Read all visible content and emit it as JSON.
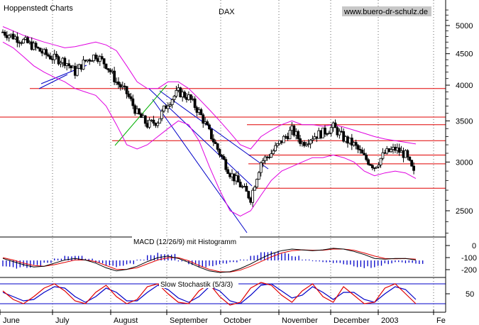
{
  "header": {
    "source": "Hoppenstedt Charts",
    "title": "DAX",
    "website": "www.buero-dr-schulz.de"
  },
  "chart_data": [
    {
      "type": "candlestick",
      "title": "DAX",
      "xlabel": "",
      "ylabel": "",
      "yscale": "log",
      "x_ticks": [
        "June",
        "July",
        "August",
        "September",
        "October",
        "November",
        "December",
        "2003",
        "Fe"
      ],
      "y_ticks": [
        2500,
        3000,
        3500,
        4000,
        4500,
        5000
      ],
      "ylim": [
        2000,
        5300
      ],
      "grid": "vertical dotted",
      "close_by_week": [
        4880,
        4800,
        4720,
        4620,
        4500,
        4420,
        4380,
        4200,
        4380,
        4480,
        4320,
        4050,
        3880,
        3600,
        3450,
        3500,
        3750,
        3900,
        3820,
        3620,
        3350,
        3100,
        2880,
        2750,
        2620,
        3000,
        3100,
        3250,
        3380,
        3220,
        3300,
        3350,
        3420,
        3280,
        3200,
        3050,
        2950,
        3100,
        3150,
        3080,
        2820
      ],
      "horizontal_levels": [
        3950,
        3550,
        3450,
        3250,
        3080,
        2980,
        2720
      ],
      "bollinger_upper": [
        4980,
        4900,
        4820,
        4760,
        4700,
        4650,
        4600,
        4620,
        4660,
        4700,
        4650,
        4550,
        4300,
        4050,
        3950,
        3950,
        4050,
        4050,
        3950,
        3800,
        3650,
        3500,
        3350,
        3200,
        3150,
        3300,
        3380,
        3450,
        3500,
        3450,
        3450,
        3430,
        3450,
        3420,
        3380,
        3340,
        3300,
        3270,
        3250,
        3230,
        3210
      ],
      "bollinger_lower": [
        4700,
        4600,
        4450,
        4300,
        4200,
        4120,
        4050,
        3950,
        3900,
        3850,
        3700,
        3450,
        3200,
        3150,
        3200,
        3300,
        3400,
        3500,
        3450,
        3250,
        2950,
        2700,
        2500,
        2450,
        2500,
        2650,
        2800,
        2900,
        2950,
        3000,
        3050,
        3050,
        3080,
        3050,
        3000,
        2900,
        2850,
        2880,
        2900,
        2880,
        2820
      ]
    },
    {
      "type": "line",
      "title": "MACD (12/26/9) mit Histogramm",
      "y_ticks": [
        0,
        -100,
        -200
      ],
      "macd": [
        -20,
        -60,
        -100,
        -130,
        -120,
        -80,
        -40,
        -20,
        -40,
        -80,
        -140,
        -180,
        -160,
        -120,
        -60,
        -10,
        10,
        -20,
        -70,
        -130,
        -180,
        -200,
        -190,
        -150,
        -90,
        -20,
        40,
        80,
        100,
        90,
        80,
        90,
        110,
        100,
        70,
        30,
        -20,
        -30,
        -20,
        -20,
        -40
      ],
      "signal": [
        -10,
        -40,
        -80,
        -110,
        -120,
        -100,
        -70,
        -40,
        -40,
        -60,
        -110,
        -160,
        -160,
        -140,
        -90,
        -40,
        -10,
        -10,
        -50,
        -110,
        -160,
        -190,
        -195,
        -170,
        -120,
        -60,
        0,
        50,
        80,
        90,
        85,
        85,
        100,
        100,
        85,
        50,
        10,
        -20,
        -25,
        -22,
        -30
      ],
      "histogram": [
        -70,
        -90,
        -80,
        -60,
        -30,
        20,
        50,
        60,
        20,
        -30,
        -60,
        -70,
        -40,
        10,
        60,
        80,
        70,
        -10,
        -50,
        -70,
        -60,
        -40,
        -20,
        10,
        60,
        90,
        100,
        80,
        50,
        10,
        -10,
        -20,
        -30,
        -50,
        -70,
        -80,
        -70,
        -40,
        -20,
        -30,
        -40
      ]
    },
    {
      "type": "line",
      "title": "Slow Stochastik (5/3/3)",
      "y_ticks": [
        50
      ],
      "levels": [
        80,
        20
      ],
      "k": [
        60,
        30,
        15,
        40,
        70,
        85,
        60,
        25,
        15,
        55,
        80,
        40,
        15,
        30,
        75,
        85,
        50,
        20,
        15,
        60,
        85,
        40,
        10,
        20,
        70,
        90,
        80,
        45,
        20,
        60,
        85,
        40,
        20,
        75,
        45,
        15,
        20,
        70,
        85,
        50,
        15
      ],
      "d": [
        55,
        40,
        25,
        30,
        55,
        75,
        70,
        40,
        20,
        40,
        70,
        55,
        25,
        25,
        55,
        80,
        65,
        35,
        20,
        40,
        75,
        60,
        25,
        15,
        45,
        80,
        85,
        60,
        35,
        45,
        75,
        55,
        30,
        55,
        55,
        30,
        20,
        50,
        75,
        65,
        30
      ]
    }
  ]
}
